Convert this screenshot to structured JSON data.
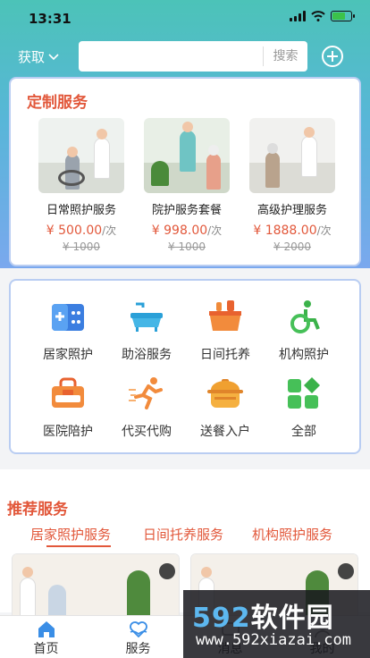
{
  "status_bar": {
    "time": "13:31"
  },
  "header": {
    "city_label": "获取",
    "search_placeholder": "",
    "search_button": "搜索"
  },
  "custom_services": {
    "title": "定制服务",
    "items": [
      {
        "name": "日常照护服务",
        "price": "¥ 500.00",
        "unit": "/次",
        "original_price": "¥ 1000"
      },
      {
        "name": "院护服务套餐",
        "price": "¥ 998.00",
        "unit": "/次",
        "original_price": "¥ 1000"
      },
      {
        "name": "高级护理服务",
        "price": "¥ 1888.00",
        "unit": "/次",
        "original_price": "¥ 2000"
      }
    ]
  },
  "service_grid": [
    {
      "label": "居家照护",
      "icon": "home-care-icon"
    },
    {
      "label": "助浴服务",
      "icon": "bathtub-icon"
    },
    {
      "label": "日间托养",
      "icon": "daycare-basket-icon"
    },
    {
      "label": "机构照护",
      "icon": "wheelchair-icon"
    },
    {
      "label": "医院陪护",
      "icon": "hospital-escort-icon"
    },
    {
      "label": "代买代购",
      "icon": "runner-icon"
    },
    {
      "label": "送餐入户",
      "icon": "meal-pot-icon"
    },
    {
      "label": "全部",
      "icon": "all-grid-icon"
    }
  ],
  "recommended": {
    "title": "推荐服务",
    "tabs": [
      "居家照护服务",
      "日间托养服务",
      "机构照护服务"
    ]
  },
  "tabbar": [
    {
      "label": "首页",
      "icon": "home-icon"
    },
    {
      "label": "服务",
      "icon": "service-heart-icon"
    },
    {
      "label": "消息",
      "icon": "message-icon"
    },
    {
      "label": "我的",
      "icon": "profile-icon"
    }
  ],
  "watermark": {
    "text_latin": "592",
    "text_cn": "软件园",
    "url": "www.592xiazai.com"
  },
  "colors": {
    "accent": "#e2583b",
    "header_top": "#4cc3b8",
    "header_bottom": "#7aa8ee",
    "card_border": "#b9cdf2"
  }
}
